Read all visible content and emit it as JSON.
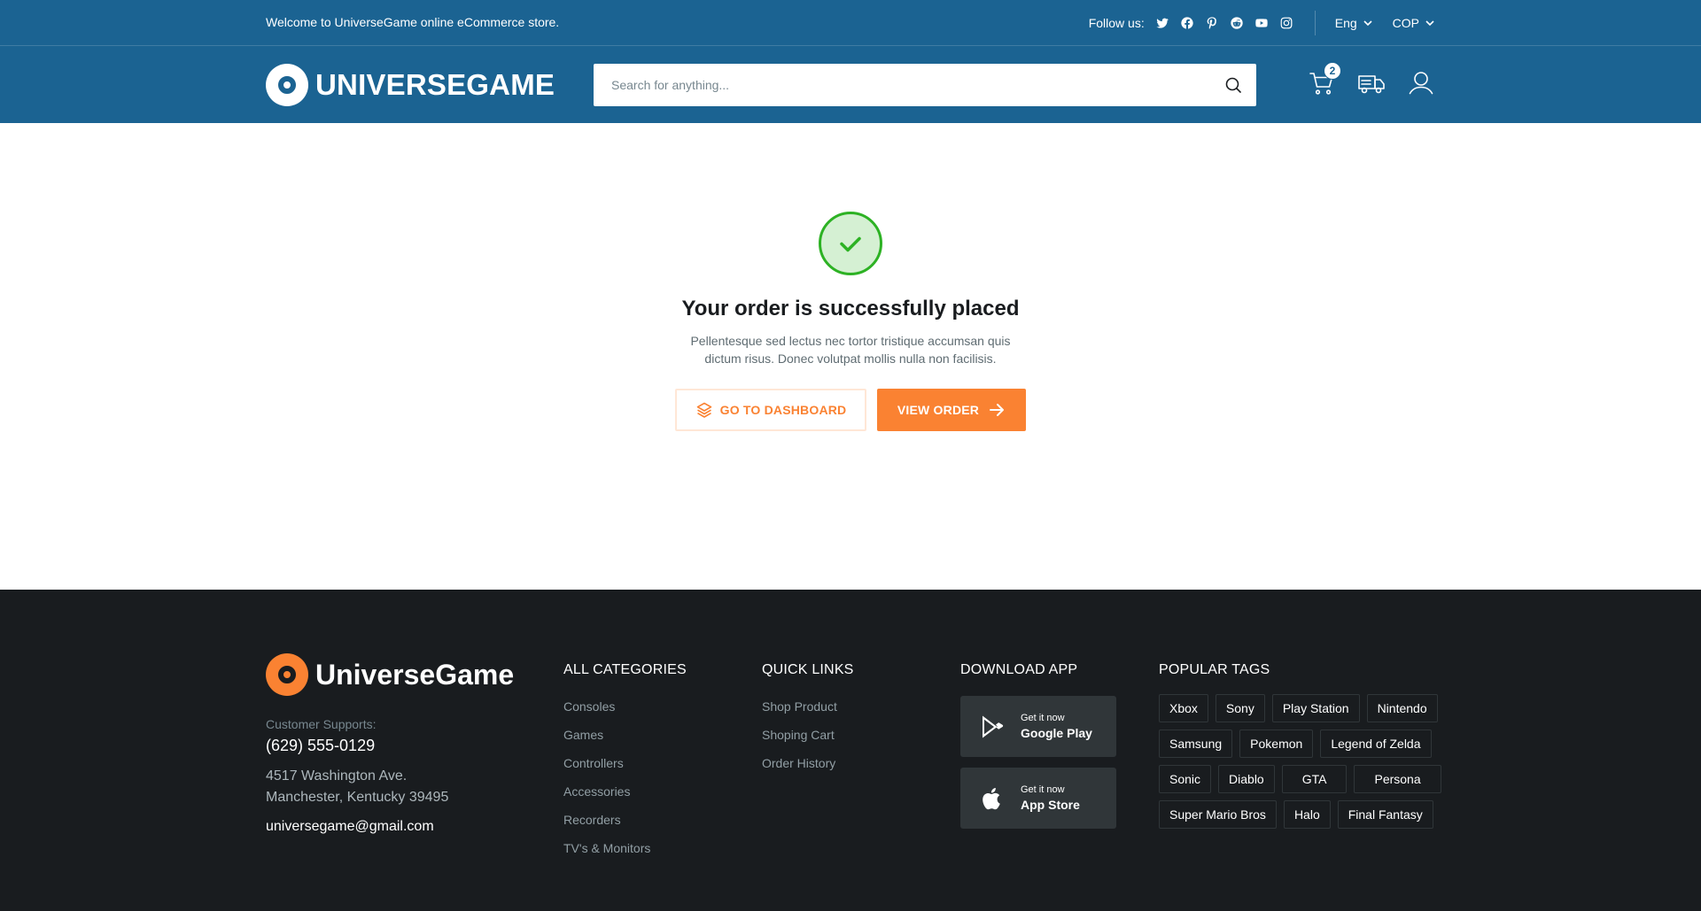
{
  "topbar": {
    "welcome": "Welcome to UniverseGame online eCommerce store.",
    "follow_label": "Follow us:",
    "social": [
      "twitter-icon",
      "facebook-icon",
      "pinterest-icon",
      "reddit-icon",
      "youtube-icon",
      "instagram-icon"
    ],
    "language": "Eng",
    "currency": "COP"
  },
  "header": {
    "logo_text": "UNIVERSEGAME",
    "search_placeholder": "Search for anything...",
    "cart_count": "2",
    "icons": [
      "cart-icon",
      "truck-icon",
      "user-icon"
    ]
  },
  "main": {
    "title": "Your order is successfully placed",
    "description": "Pellentesque sed lectus nec tortor tristique accumsan quis dictum risus. Donec volutpat mollis nulla non facilisis.",
    "dashboard_button": "GO TO DASHBOARD",
    "view_order_button": "VIEW ORDER"
  },
  "footer": {
    "logo_text": "UniverseGame",
    "support_label": "Customer Supports:",
    "phone": "(629) 555-0129",
    "address_line1": "4517 Washington Ave.",
    "address_line2": "Manchester, Kentucky 39495",
    "email": "universegame@gmail.com",
    "categories": {
      "heading": "ALL CATEGORIES",
      "items": [
        "Consoles",
        "Games",
        "Controllers",
        "Accessories",
        "Recorders",
        "TV's & Monitors"
      ]
    },
    "quick_links": {
      "heading": "QUICK LINKS",
      "items": [
        "Shop Product",
        "Shoping Cart",
        "Order History"
      ]
    },
    "download": {
      "heading": "DOWNLOAD APP",
      "google_small": "Get it now",
      "google_big": "Google Play",
      "apple_small": "Get it now",
      "apple_big": "App Store"
    },
    "tags": {
      "heading": "POPULAR TAGS",
      "items": [
        "Xbox",
        "Sony",
        "Play Station",
        "Nintendo",
        "Samsung",
        "Pokemon",
        "Legend of Zelda",
        "Sonic",
        "Diablo",
        "GTA",
        "Persona",
        "Super Mario Bros",
        "Halo",
        "Final Fantasy"
      ]
    }
  },
  "colors": {
    "primary": "#1b6392",
    "accent": "#fa8232",
    "success": "#2db224",
    "footer_bg": "#191c1f"
  }
}
